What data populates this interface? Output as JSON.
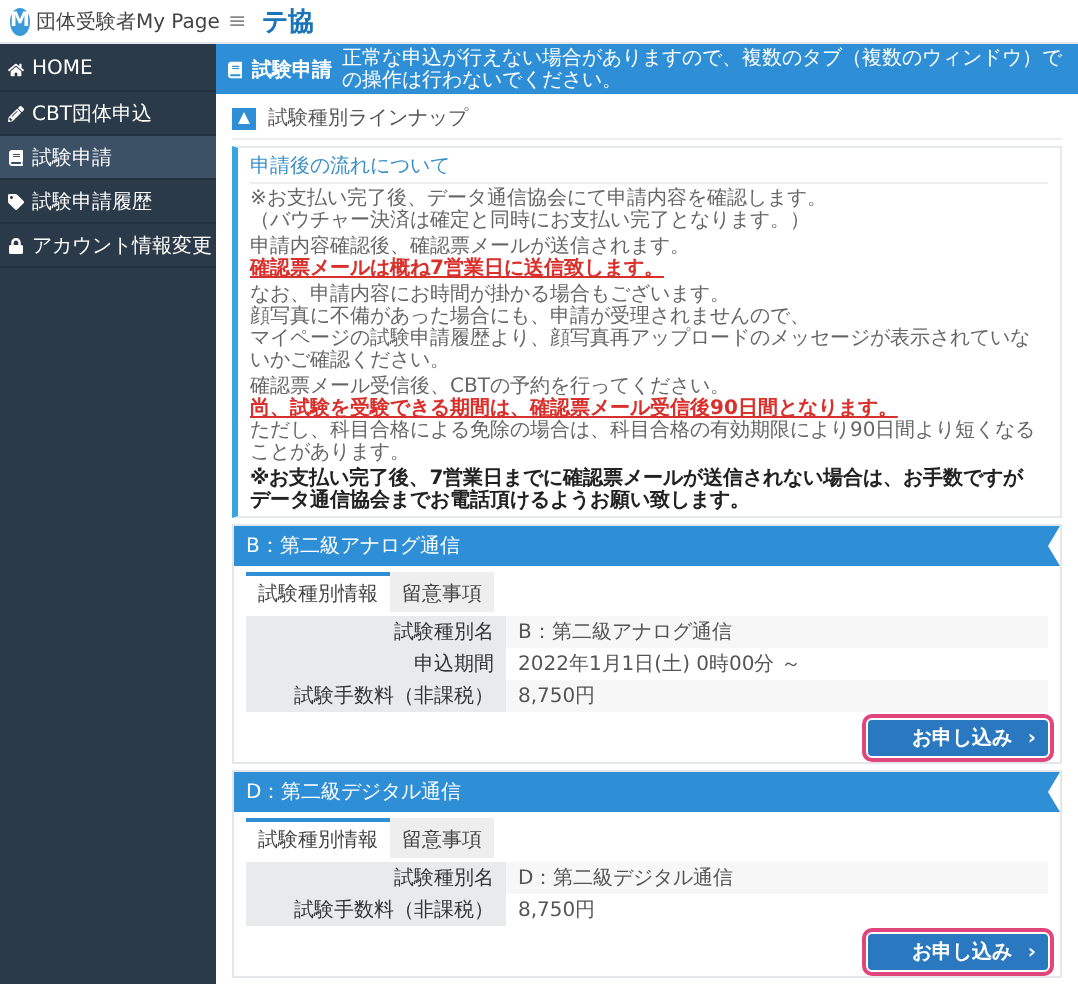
{
  "app": {
    "logo_letter": "M",
    "title": "団体受験者My Page"
  },
  "topbar": {
    "menu_glyph": "≡",
    "brand": "テ協"
  },
  "sidebar": {
    "items": [
      {
        "label": "HOME",
        "selected": false
      },
      {
        "label": "CBT団体申込",
        "selected": false
      },
      {
        "label": "試験申請",
        "selected": true
      },
      {
        "label": "試験申請履歴",
        "selected": false
      },
      {
        "label": "アカウント情報変更",
        "selected": false
      }
    ]
  },
  "page_header": {
    "title": "試験申請",
    "notice": "正常な申込が行えない場合がありますので、複数のタブ（複数のウィンドウ）での操作は行わないでください。"
  },
  "section_title": "試験種別ラインナップ",
  "info": {
    "title": "申請後の流れについて",
    "paragraphs": [
      [
        {
          "text": "※お支払い完了後、データ通信協会にて申請内容を確認します。",
          "kind": "plain"
        },
        {
          "text": "（バウチャー決済は確定と同時にお支払い完了となります。）",
          "kind": "plain"
        }
      ],
      [
        {
          "text": "申請内容確認後、確認票メールが送信されます。",
          "kind": "plain"
        },
        {
          "text": "確認票メールは概ね7営業日に送信致します。",
          "kind": "warning"
        }
      ],
      [
        {
          "text": "なお、申請内容にお時間が掛かる場合もございます。",
          "kind": "plain"
        },
        {
          "text": "顔写真に不備があった場合にも、申請が受理されませんので、",
          "kind": "plain"
        },
        {
          "text": "マイページの試験申請履歴より、顔写真再アップロードのメッセージが表示されていないかご確認ください。",
          "kind": "plain"
        }
      ],
      [
        {
          "text": "確認票メール受信後、CBTの予約を行ってください。",
          "kind": "plain"
        },
        {
          "text": "尚、試験を受験できる期間は、確認票メール受信後90日間となります。",
          "kind": "warning"
        },
        {
          "text": "ただし、科目合格による免除の場合は、科目合格の有効期限により90日間より短くなることがあります。",
          "kind": "plain"
        }
      ],
      [
        {
          "text": "※お支払い完了後、7営業日までに確認票メールが送信されない場合は、お手数ですが",
          "kind": "note"
        },
        {
          "text": "データ通信協会までお電話頂けるようお願い致します。",
          "kind": "note"
        }
      ]
    ]
  },
  "exams": [
    {
      "title": "B：第二級アナログ通信",
      "tabs": [
        {
          "label": "試験種別情報",
          "selected": true
        },
        {
          "label": "留意事項",
          "selected": false
        }
      ],
      "rows": [
        {
          "label": "試験種別名",
          "value": "B：第二級アナログ通信"
        },
        {
          "label": "申込期間",
          "value": "2022年1月1日(土) 0時00分 ～"
        },
        {
          "label": "試験手数料（非課税）",
          "value": "8,750円"
        }
      ],
      "button": {
        "label": "お申し込み",
        "glyph": "›",
        "highlighted": true
      }
    },
    {
      "title": "D：第二級デジタル通信",
      "tabs": [
        {
          "label": "試験種別情報",
          "selected": true
        },
        {
          "label": "留意事項",
          "selected": false
        }
      ],
      "rows": [
        {
          "label": "試験種別名",
          "value": "D：第二級デジタル通信"
        },
        {
          "label": "試験手数料（非課税）",
          "value": "8,750円"
        }
      ],
      "button": {
        "label": "お申し込み",
        "glyph": "›",
        "highlighted": true
      }
    }
  ]
}
